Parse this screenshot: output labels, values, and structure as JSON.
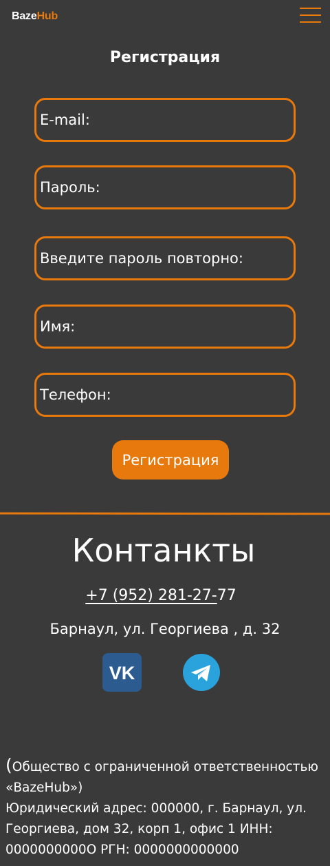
{
  "header": {
    "logo_part1": "Baze",
    "logo_part2": "Hub",
    "menu_icon": "hamburger-menu-icon"
  },
  "form": {
    "title": "Регистрация",
    "fields": [
      {
        "placeholder": "E-mail:"
      },
      {
        "placeholder": "Пароль:"
      },
      {
        "placeholder": "Введите пароль повторно:"
      },
      {
        "placeholder": "Имя:"
      },
      {
        "placeholder": "Телефон:"
      }
    ],
    "submit_label": "Регистрация"
  },
  "contacts": {
    "title": "Контанкты",
    "phone_link": "+7 (952) 281-27-",
    "phone_tail": "77",
    "address": "Барнаул, ул. Георгиева , д. 32",
    "social": [
      {
        "icon": "vk-icon",
        "text": "VK"
      },
      {
        "icon": "telegram-icon"
      }
    ]
  },
  "legal": {
    "open_paren": "(",
    "company": "Общество с ограниченной ответственностью «BazeHub»)",
    "details": "Юридический адрес: 000000, г. Барнаул, ул. Георгиева, дом 32, корп 1, офис 1 ИНН: 0000000000О РГН: 0000000000000"
  },
  "colors": {
    "accent": "#e7790d",
    "background": "#3a3a3a",
    "vk": "#2c5b8f",
    "telegram": "#2aa3dc"
  }
}
